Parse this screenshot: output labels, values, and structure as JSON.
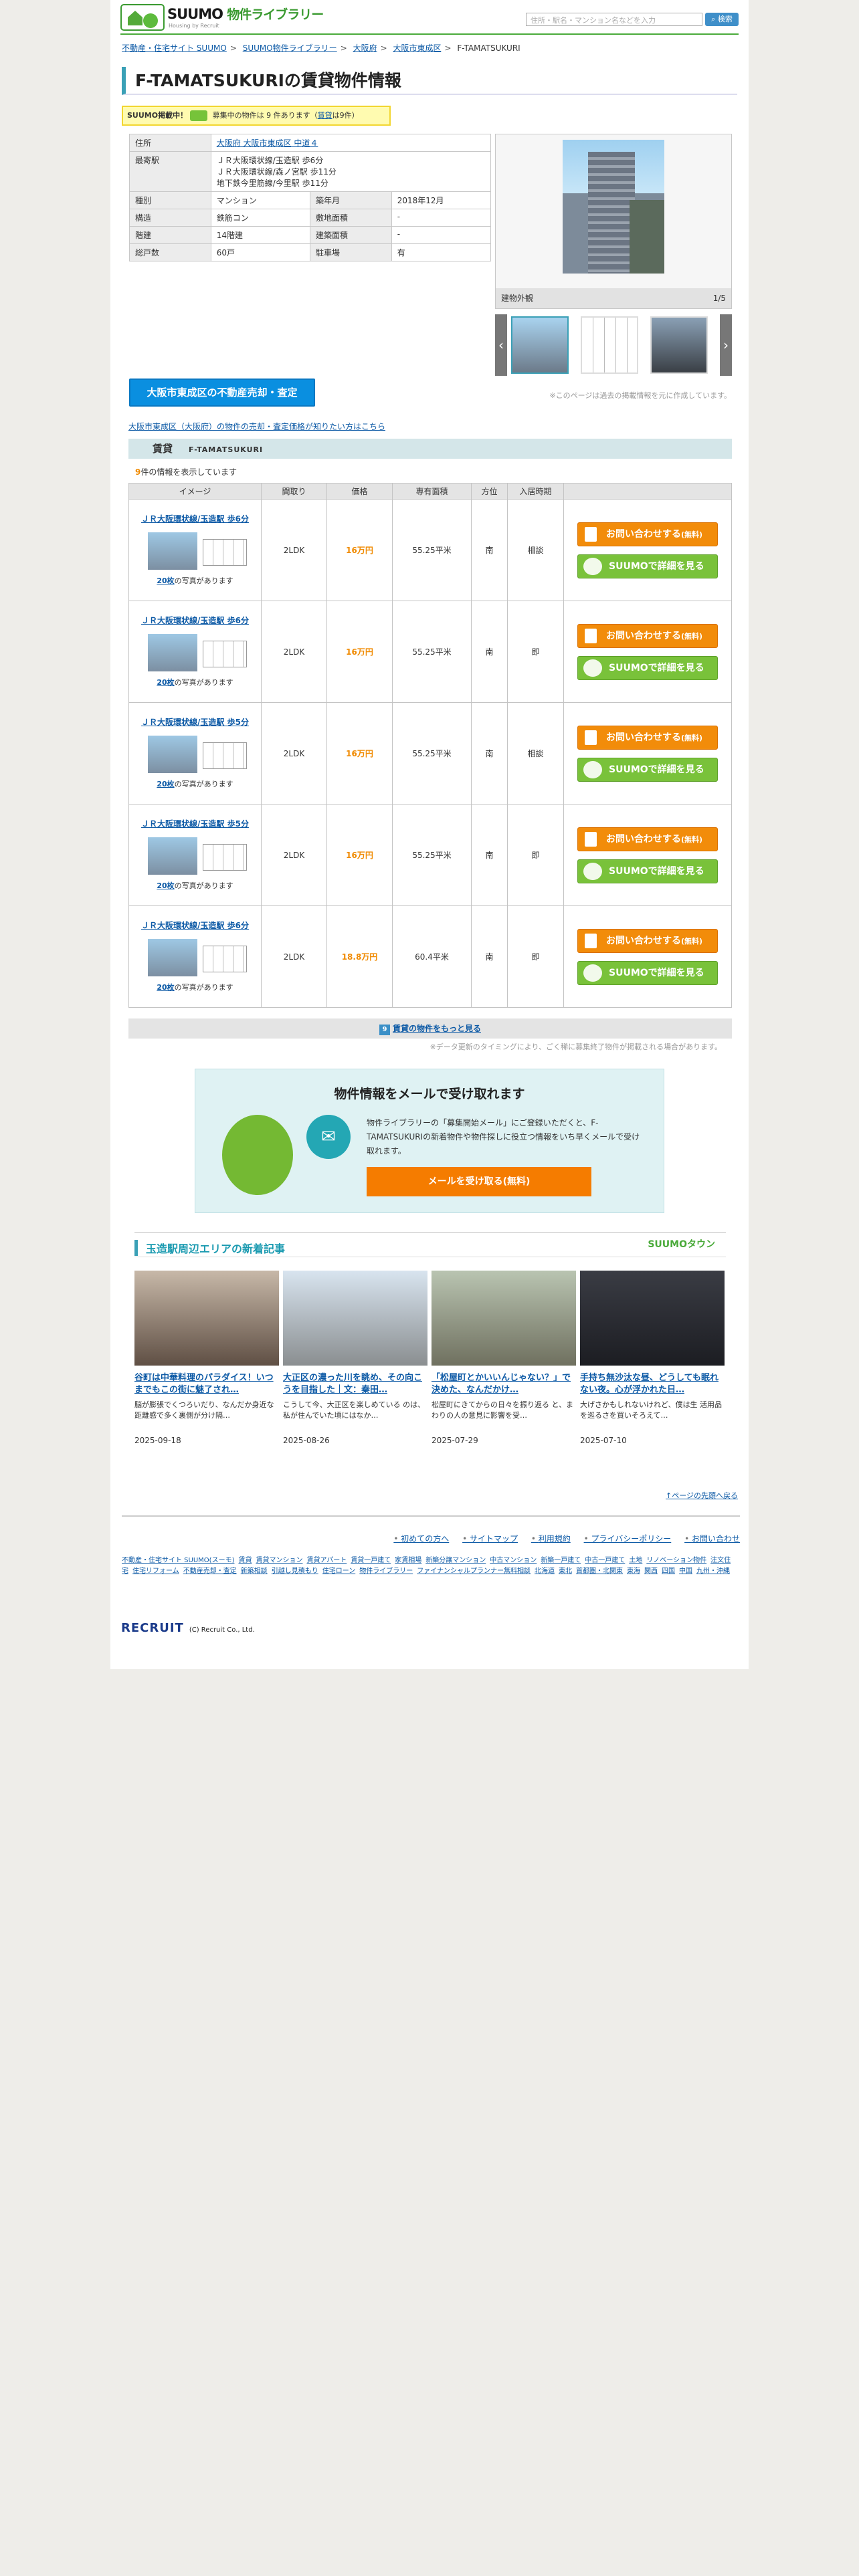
{
  "header": {
    "logo": "SUUMO",
    "library": "物件ライブラリー",
    "logo_sub": "Housing by Recruit",
    "search_placeholder": "住所・駅名・マンション名などを入力",
    "search_button": "検索"
  },
  "breadcrumb": [
    "不動産・住宅サイト SUUMO",
    "SUUMO物件ライブラリー",
    "大阪府",
    "大阪市東成区",
    "F-TAMATSUKURI"
  ],
  "title": "F-TAMATSUKURIの賃貸物件情報",
  "notice": {
    "badge": "SUUMO掲載中！",
    "text": "募集中の物件は",
    "count": "9",
    "unit": "件あります（",
    "link": "賃貸",
    "tail": "は9件）"
  },
  "info": {
    "address_label": "住所",
    "address": "大阪府 大阪市東成区 中道４",
    "station_label": "最寄駅",
    "stations": [
      "ＪＲ大阪環状線/玉造駅 歩6分",
      "ＪＲ大阪環状線/森ノ宮駅 歩11分",
      "地下鉄今里筋線/今里駅 歩11分"
    ],
    "type_label": "種別",
    "type": "マンション",
    "built_label": "築年月",
    "built": "2018年12月",
    "struct_label": "構造",
    "struct": "鉄筋コン",
    "land_label": "敷地面積",
    "land": "-",
    "floors_label": "階建",
    "floors": "14階建",
    "bldg_label": "建築面積",
    "bldg": "-",
    "units_label": "総戸数",
    "units": "60戸",
    "parking_label": "駐車場",
    "parking": "有"
  },
  "photo": {
    "caption": "建物外観",
    "counter": "1/5"
  },
  "photo_note": "※このページは過去の掲載情報を元に作成しています。",
  "sell_button": "大阪市東成区の不動産売却・査定",
  "sell_link": "大阪市東成区（大阪府）の物件の売却・査定価格が知りたい方はこちら",
  "section": {
    "title": "賃貸",
    "sub": "F-TAMATSUKURI"
  },
  "count_line": {
    "count": "9",
    "text": "件の情報を表示しています"
  },
  "columns": [
    "イメージ",
    "間取り",
    "価格",
    "専有面積",
    "方位",
    "入居時期",
    ""
  ],
  "listings": [
    {
      "station": "ＪＲ大阪環状線/玉造駅 歩6分",
      "photos": "20枚",
      "photos_tail": "の写真があります",
      "layout": "2LDK",
      "price": "16万円",
      "area": "55.25平米",
      "dir": "南",
      "move": "相談"
    },
    {
      "station": "ＪＲ大阪環状線/玉造駅 歩6分",
      "photos": "20枚",
      "photos_tail": "の写真があります",
      "layout": "2LDK",
      "price": "16万円",
      "area": "55.25平米",
      "dir": "南",
      "move": "即"
    },
    {
      "station": "ＪＲ大阪環状線/玉造駅 歩5分",
      "photos": "20枚",
      "photos_tail": "の写真があります",
      "layout": "2LDK",
      "price": "16万円",
      "area": "55.25平米",
      "dir": "南",
      "move": "相談"
    },
    {
      "station": "ＪＲ大阪環状線/玉造駅 歩5分",
      "photos": "20枚",
      "photos_tail": "の写真があります",
      "layout": "2LDK",
      "price": "16万円",
      "area": "55.25平米",
      "dir": "南",
      "move": "即"
    },
    {
      "station": "ＪＲ大阪環状線/玉造駅 歩6分",
      "photos": "20枚",
      "photos_tail": "の写真があります",
      "layout": "2LDK",
      "price": "18.8万円",
      "area": "60.4平米",
      "dir": "南",
      "move": "即"
    }
  ],
  "btn_inquiry": "お問い合わせする",
  "btn_inquiry_small": "(無料)",
  "btn_detail": "SUUMOで詳細を見る",
  "more": {
    "num": "9",
    "text": "賃貸の物件をもっと見る"
  },
  "more_note": "※データ更新のタイミングにより、ごく稀に募集終了物件が掲載される場合があります。",
  "mail": {
    "title": "物件情報をメールで受け取れます",
    "text": "物件ライブラリーの「募集開始メール」にご登録いただくと、F-TAMATSUKURIの新着物件や物件探しに役立つ情報をいち早くメールで受け取れます。",
    "button": "メールを受け取る(無料)"
  },
  "articles_header": "玉造駅周辺エリアの新着記事",
  "articles_brand": "SUUMOタウン",
  "articles": [
    {
      "title": "谷町は中華料理のパラダイス！いつまでもこの街に魅了され…",
      "desc": "脳が膨張でくつろいだり、なんだか身近な距離感で多く裏側が分け隔…",
      "date": "2025-09-18"
    },
    {
      "title": "大正区の濃った川を眺め、その向こうを目指した｜文：秦田…",
      "desc": "こうして今、大正区を楽しめている のは、私が住んでいた頃にはなか…",
      "date": "2025-08-26"
    },
    {
      "title": "「松屋町とかいいんじゃない？」で決めた、なんだかけ…",
      "desc": "松屋町にきてからの日々を振り返る と、まわりの人の意見に影響を受…",
      "date": "2025-07-29"
    },
    {
      "title": "手持ち無沙汰な昼、どうしても眠れない夜。心が浮かれた日…",
      "desc": "大げさかもしれないけれど、僕は生 活用品を巡るさを買いそろえて…",
      "date": "2025-07-10"
    }
  ],
  "to_top": "↑ページの先頭へ戻る",
  "footer_links": [
    "初めての方へ",
    "サイトマップ",
    "利用規約",
    "プライバシーポリシー",
    "お問い合わせ"
  ],
  "footer_small": [
    "不動産・住宅サイト SUUMO(スーモ)",
    "賃貸",
    "賃貸マンション",
    "賃貸アパート",
    "賃貸一戸建て",
    "家賃相場",
    "新築分譲マンション",
    "中古マンション",
    "新築一戸建て",
    "中古一戸建て",
    "土地",
    "リノベーション物件",
    "注文住宅",
    "住宅リフォーム",
    "不動産売却・査定",
    "新築相談",
    "引越し見積もり",
    "住宅ローン",
    "物件ライブラリー",
    "ファイナンシャルプランナー無料相談",
    "北海道",
    "東北",
    "首都圏・北関東",
    "東海",
    "関西",
    "四国",
    "中国",
    "九州・沖縄"
  ],
  "footer_logo": "RECRUIT",
  "copyright": "(C) Recruit Co., Ltd."
}
